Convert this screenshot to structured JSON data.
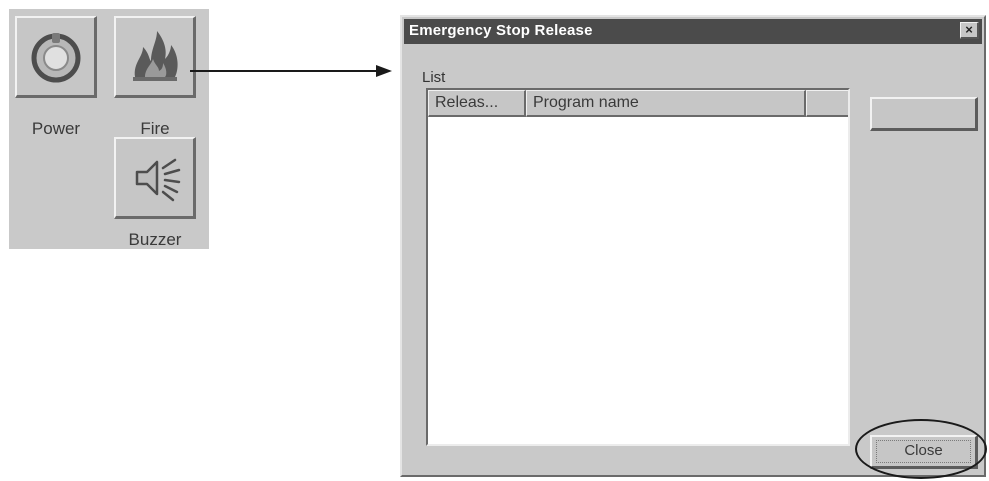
{
  "toolbar": {
    "buttons": [
      {
        "id": "power",
        "label": "Power",
        "icon": "power-icon"
      },
      {
        "id": "fire",
        "label": "Fire",
        "icon": "fire-icon"
      },
      {
        "id": "buzzer",
        "label": "Buzzer",
        "icon": "buzzer-icon"
      }
    ]
  },
  "dialog": {
    "title": "Emergency Stop Release",
    "close_icon_glyph": "×",
    "list_caption": "List",
    "columns": [
      "Releas...",
      "Program name",
      ""
    ],
    "rows": [],
    "release_button_label": "",
    "close_button_label": "Close"
  },
  "colors": {
    "window_gray": "#c9c9c9",
    "titlebar": "#4b4b4b",
    "highlight_ring": "#1a1a1a"
  }
}
